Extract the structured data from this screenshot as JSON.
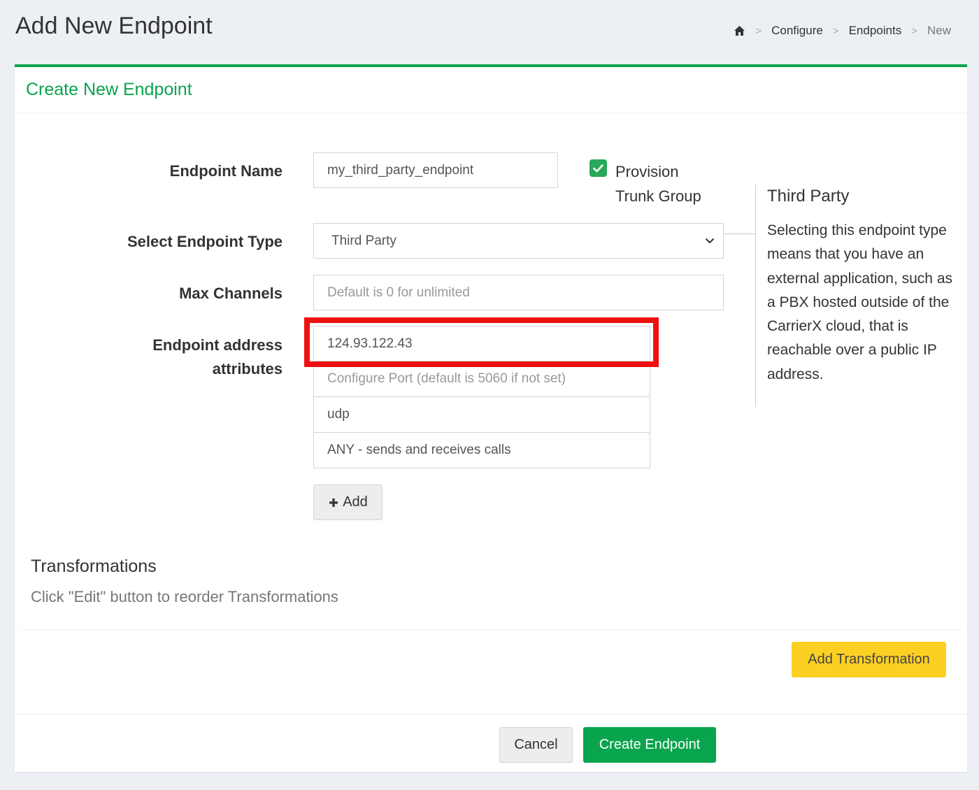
{
  "page": {
    "title": "Add New Endpoint"
  },
  "breadcrumb": {
    "items": [
      "Configure",
      "Endpoints",
      "New"
    ],
    "separator": ">"
  },
  "card": {
    "title": "Create New Endpoint"
  },
  "form": {
    "endpoint_name_label": "Endpoint Name",
    "endpoint_name_value": "my_third_party_endpoint",
    "provision_label_line1": "Provision",
    "provision_label_line2": "Trunk Group",
    "provision_checked": true,
    "endpoint_type_label": "Select Endpoint Type",
    "endpoint_type_value": "Third Party",
    "max_channels_label": "Max Channels",
    "max_channels_placeholder": "Default is 0 for unlimited",
    "address_label_line1": "Endpoint address",
    "address_label_line2": "attributes",
    "address_ip": "124.93.122.43",
    "address_port_placeholder": "Configure Port (default is 5060 if not set)",
    "address_transport": "udp",
    "address_direction": "ANY - sends and receives calls",
    "add_button": "Add"
  },
  "help": {
    "title": "Third Party",
    "text": "Selecting this endpoint type means that you have an external application, such as a PBX hosted outside of the CarrierX cloud, that is reachable over a public IP address."
  },
  "transformations": {
    "title": "Transformations",
    "subtitle": "Click \"Edit\" button to reorder Transformations",
    "add_button": "Add Transformation"
  },
  "footer": {
    "cancel_button": "Cancel",
    "create_button": "Create Endpoint"
  },
  "colors": {
    "accent_green": "#09a44e",
    "highlight_red": "#ee1111",
    "warning_yellow": "#fcd022"
  }
}
